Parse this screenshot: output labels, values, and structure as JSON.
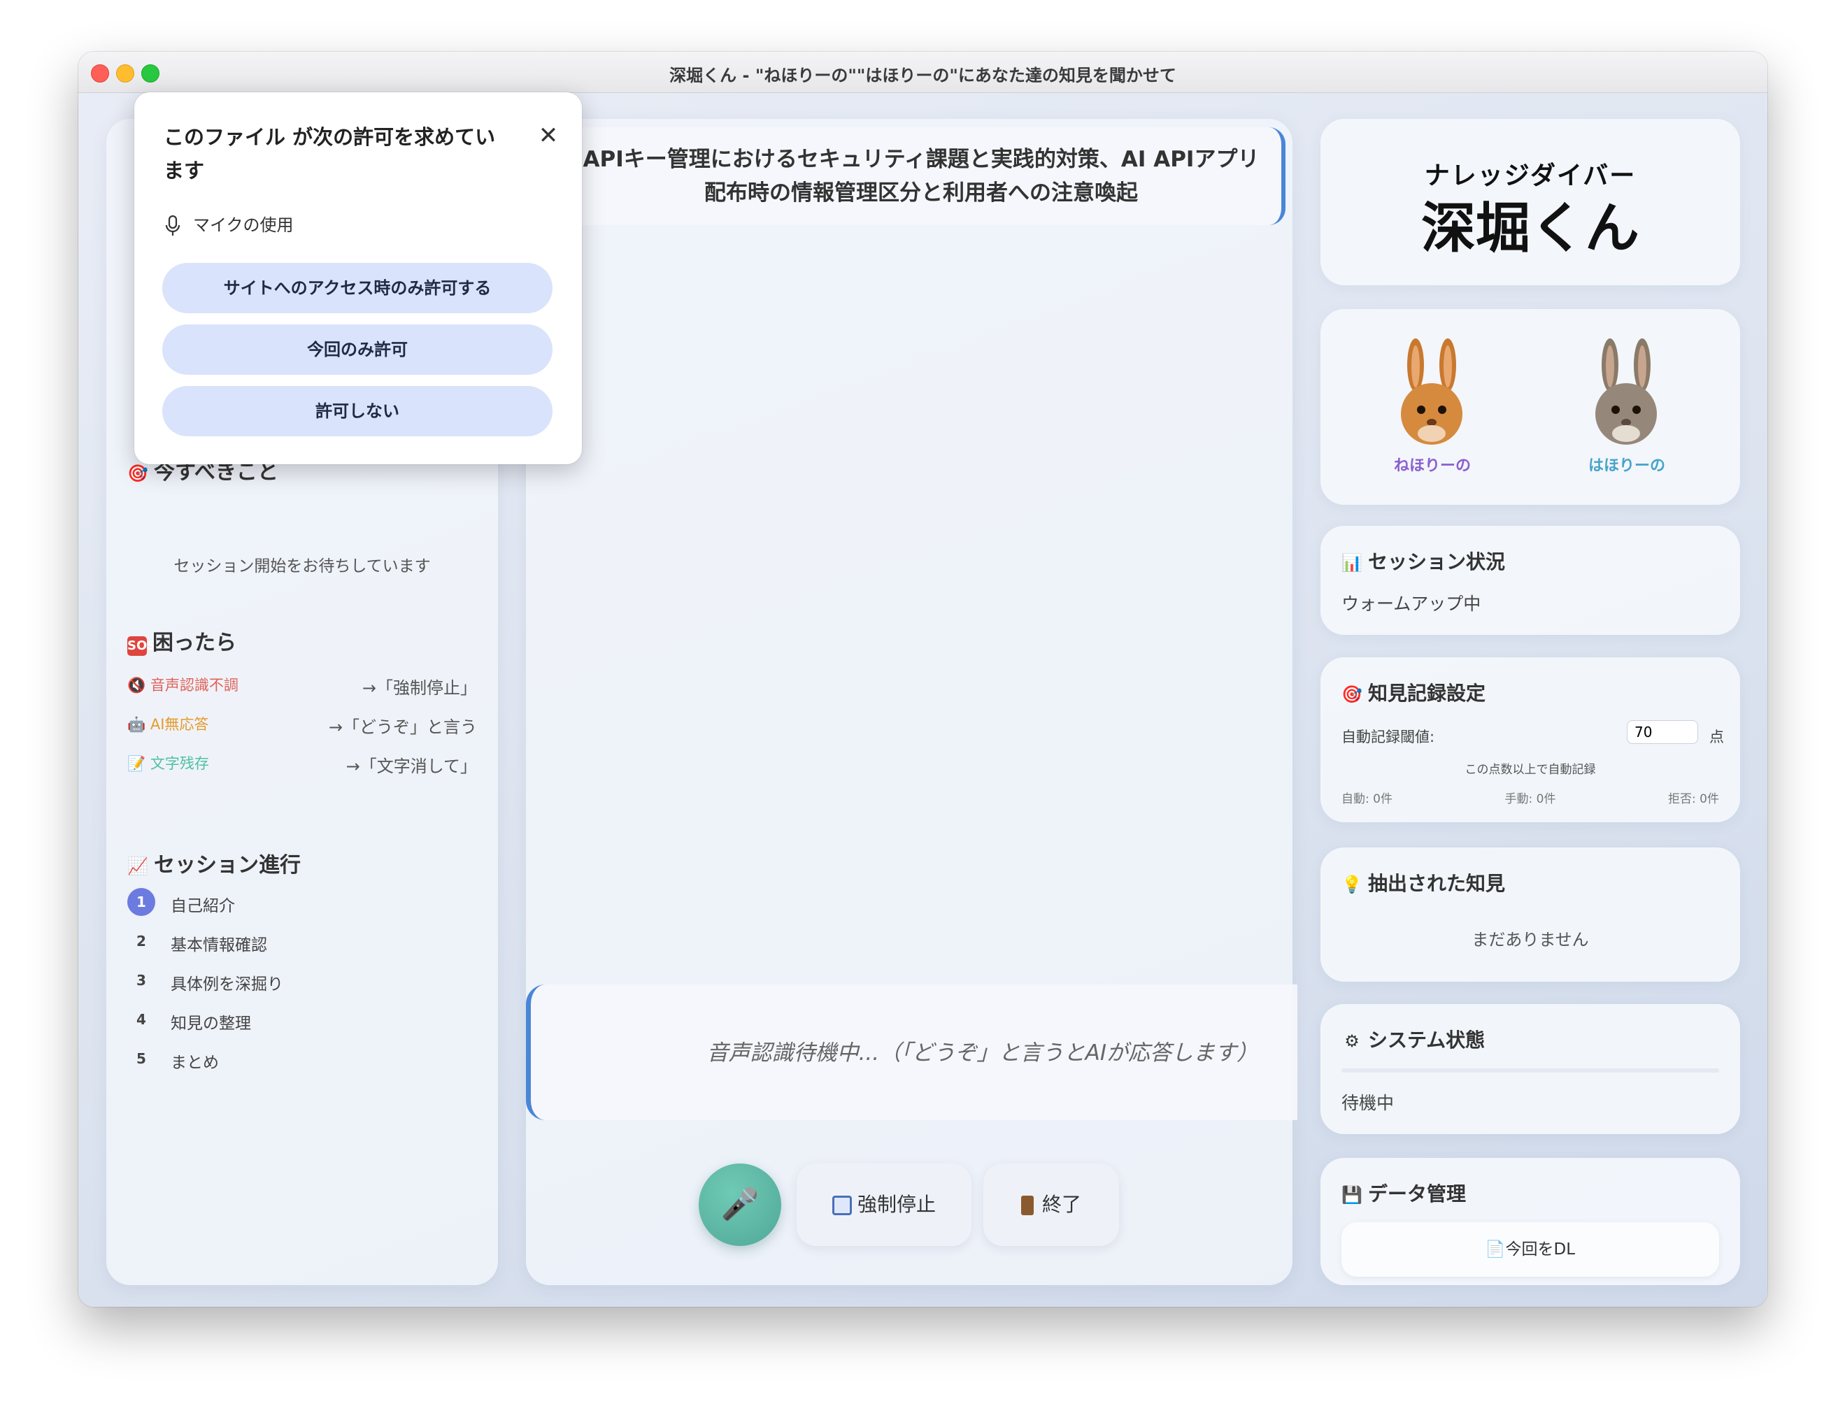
{
  "window": {
    "title": "深堀くん - \"ねほりーの\"\"はほりーの\"にあなた達の知見を聞かせて"
  },
  "popup": {
    "title": "このファイル が次の許可を求めています",
    "permission": "マイクの使用",
    "buttons": [
      "サイトへのアクセス時のみ許可する",
      "今回のみ許可",
      "許可しない"
    ]
  },
  "left": {
    "todo": {
      "icon": "target-icon",
      "title": "今すべきこと",
      "message": "セッション開始をお待ちしています"
    },
    "help": {
      "icon": "sos-icon",
      "title": "困ったら",
      "items": [
        {
          "icon": "mute-icon",
          "label": "音声認識不調",
          "action": "→「強制停止」",
          "color": "#e0615a"
        },
        {
          "icon": "robot-icon",
          "label": "AI無応答",
          "action": "→「どうぞ」と言う",
          "color": "#e59a2b"
        },
        {
          "icon": "memo-icon",
          "label": "文字残存",
          "action": "→「文字消して」",
          "color": "#4fbfa6"
        }
      ]
    },
    "progress": {
      "icon": "chart-up-icon",
      "title": "セッション進行",
      "steps": [
        {
          "num": "1",
          "label": "自己紹介"
        },
        {
          "num": "2",
          "label": "基本情報確認"
        },
        {
          "num": "3",
          "label": "具体例を深掘り"
        },
        {
          "num": "4",
          "label": "知見の整理"
        },
        {
          "num": "5",
          "label": "まとめ"
        }
      ],
      "active_step": 1
    }
  },
  "center": {
    "topic": "APIキー管理におけるセキュリティ課題と実践的対策、AI APIアプリ配布時の情報管理区分と利用者への注意喚起",
    "transcript_placeholder": "音声認識待機中...（「どうぞ」と言うとAIが応答します）",
    "controls": {
      "mic_icon": "microphone-icon",
      "stop_label": "強制停止",
      "end_label": "終了"
    }
  },
  "right": {
    "logo": {
      "subtitle": "ナレッジダイバー",
      "title": "深堀くん"
    },
    "characters": [
      {
        "name": "ねほりーの",
        "color": "#8a5fd0"
      },
      {
        "name": "はほりーの",
        "color": "#46a3c9"
      }
    ],
    "session": {
      "icon": "bar-chart-icon",
      "title": "セッション状況",
      "status": "ウォームアップ中"
    },
    "record": {
      "icon": "target-icon",
      "title": "知見記録設定",
      "threshold_label": "自動記録閾値:",
      "threshold_value": "70",
      "unit": "点",
      "hint": "この点数以上で自動記録",
      "auto": "自動: 0件",
      "manual": "手動: 0件",
      "rejected": "拒否: 0件"
    },
    "insights": {
      "icon": "lightbulb-icon",
      "title": "抽出された知見",
      "empty": "まだありません"
    },
    "system": {
      "icon": "gear-icon",
      "title": "システム状態",
      "status": "待機中"
    },
    "data": {
      "icon": "floppy-icon",
      "title": "データ管理",
      "download": "今回をDL"
    }
  }
}
